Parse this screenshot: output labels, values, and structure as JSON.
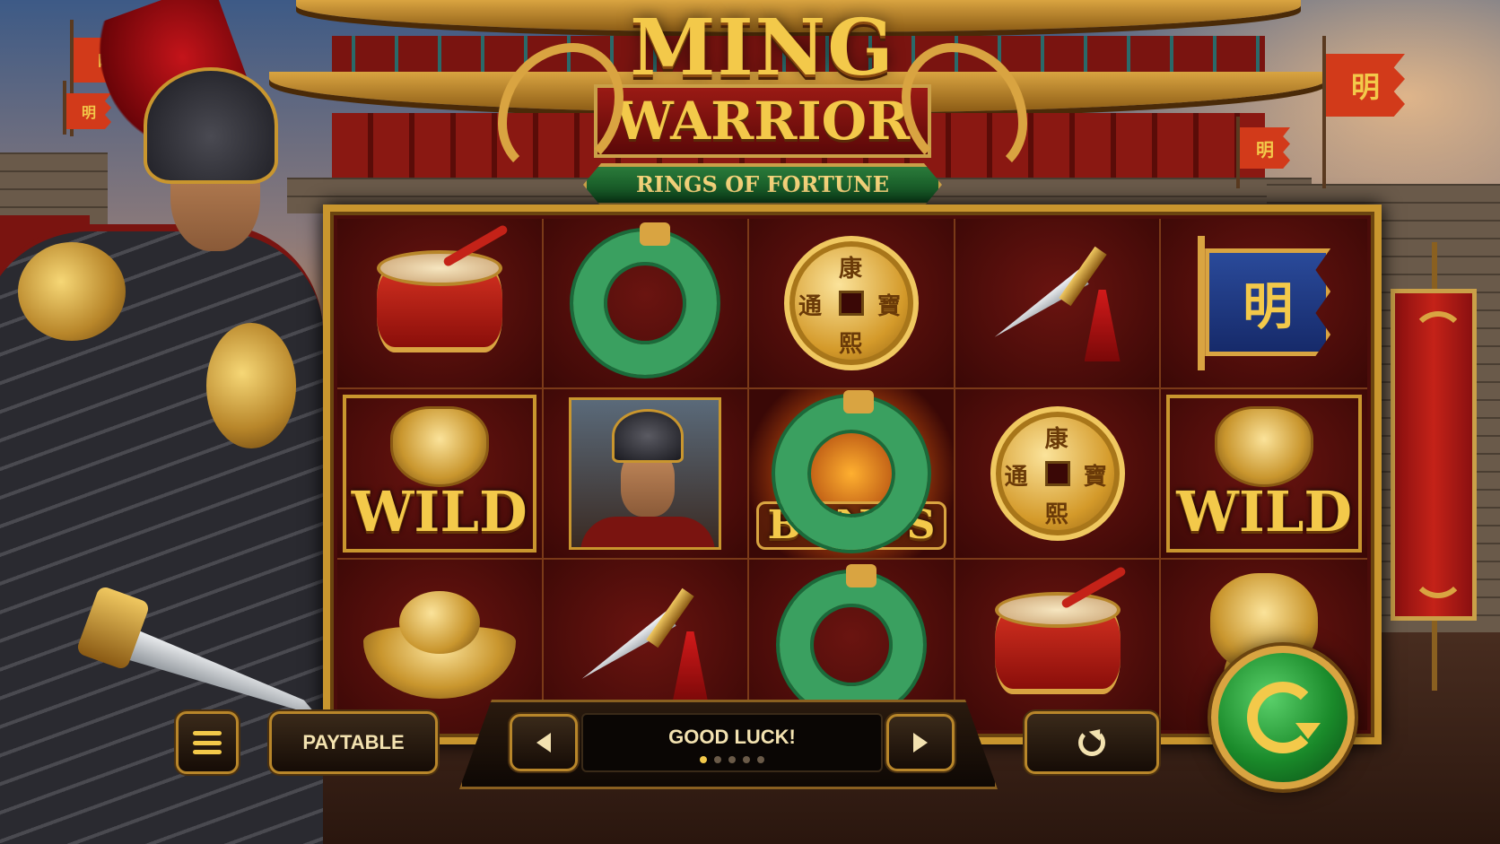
{
  "title": {
    "line1": "MING",
    "line2": "WARRIOR",
    "subtitle": "RINGS OF FORTUNE"
  },
  "banner_char": "明",
  "flag_char": "明",
  "coin_chars": [
    "康",
    "熙",
    "通",
    "寶"
  ],
  "reels": [
    [
      "drum-icon",
      "jade-ring-icon",
      "gold-coin-icon",
      "dagger-icon",
      "ming-flag-icon"
    ],
    [
      "wild",
      "warrior-portrait",
      "bonus",
      "gold-coin-icon",
      "wild"
    ],
    [
      "gold-ingot-icon",
      "dagger-icon",
      "jade-ring-icon",
      "drum-icon",
      "lion-knocker-icon"
    ]
  ],
  "symbols": {
    "wild_label": "WILD",
    "bonus_label": "BONUS"
  },
  "controls": {
    "menu_icon": "hamburger-menu-icon",
    "paytable_label": "PAYTABLE",
    "message": "GOOD LUCK!",
    "message_page": 1,
    "message_pages": 5,
    "autoplay_icon": "refresh-icon",
    "spin_icon": "spin-arrow-icon"
  },
  "colors": {
    "gold": "#f3c94a",
    "jade": "#3aa060",
    "crimson": "#8a1010",
    "spin_green": "#1a8a2a"
  }
}
